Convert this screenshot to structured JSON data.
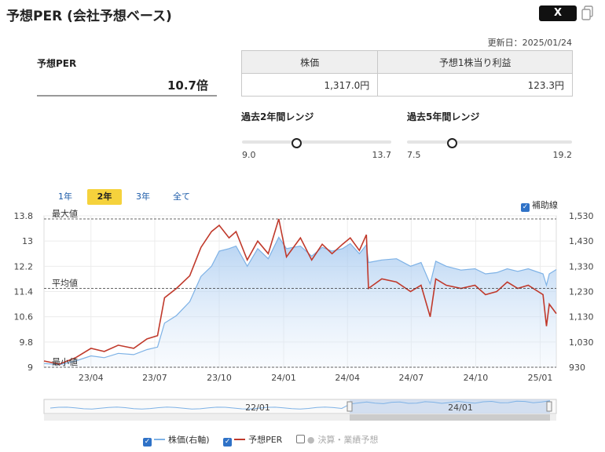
{
  "header": {
    "title": "予想PER (会社予想ベース)",
    "share_x_label": "X",
    "updated": "更新日：2025/01/24"
  },
  "per": {
    "label": "予想PER",
    "value": "10.7倍"
  },
  "table": {
    "headers": [
      "株価",
      "予想1株当り利益"
    ],
    "values": [
      "1,317.0円",
      "123.3円"
    ]
  },
  "ranges": [
    {
      "title": "過去2年間レンジ",
      "min": "9.0",
      "max": "13.7",
      "current": 10.7,
      "min_v": 9.0,
      "max_v": 13.7
    },
    {
      "title": "過去5年間レンジ",
      "min": "7.5",
      "max": "19.2",
      "current": 10.7,
      "min_v": 7.5,
      "max_v": 19.2
    }
  ],
  "period_tabs": [
    "1年",
    "2年",
    "3年",
    "全て"
  ],
  "active_tab": "2年",
  "aux_lines_label": "補助線",
  "legend": {
    "price": "株価(右軸)",
    "per": "予想PER",
    "forecast": "決算・業績予想"
  },
  "colors": {
    "price_line": "#7eb2e6",
    "per_line": "#c0392b",
    "active_tab": "#f5d23c",
    "checkbox": "#2f72c7"
  },
  "chart_data": {
    "type": "line",
    "left_axis": {
      "ticks": [
        "13.8",
        "13",
        "12.2",
        "11.4",
        "10.6",
        "9.8",
        "9"
      ],
      "range": [
        9,
        13.8
      ]
    },
    "right_axis": {
      "ticks": [
        "1,530",
        "1,430",
        "1,330",
        "1,230",
        "1,130",
        "1,030",
        "930"
      ],
      "range": [
        930,
        1530
      ]
    },
    "x_ticks": [
      "23/04",
      "23/07",
      "23/10",
      "24/01",
      "24/04",
      "24/07",
      "24/10",
      "25/01"
    ],
    "reference_lines": [
      {
        "label": "最大値",
        "value": 13.7
      },
      {
        "label": "平均値",
        "value": 11.5
      },
      {
        "label": "最小値",
        "value": 9.0
      }
    ],
    "navigator_ticks": [
      "22/01",
      "24/01"
    ],
    "series": [
      {
        "name": "予想PER",
        "axis": "left",
        "x": [
          "2023-01-24",
          "2023-02-15",
          "2023-03-10",
          "2023-04-01",
          "2023-04-20",
          "2023-05-10",
          "2023-06-01",
          "2023-06-20",
          "2023-07-05",
          "2023-07-15",
          "2023-08-01",
          "2023-08-20",
          "2023-09-05",
          "2023-09-20",
          "2023-10-01",
          "2023-10-15",
          "2023-10-25",
          "2023-11-10",
          "2023-11-25",
          "2023-12-10",
          "2023-12-25",
          "2024-01-05",
          "2024-01-25",
          "2024-02-10",
          "2024-02-25",
          "2024-03-10",
          "2024-03-25",
          "2024-04-05",
          "2024-04-18",
          "2024-04-28",
          "2024-05-01",
          "2024-05-20",
          "2024-06-10",
          "2024-06-30",
          "2024-07-15",
          "2024-07-28",
          "2024-08-05",
          "2024-08-20",
          "2024-09-10",
          "2024-09-30",
          "2024-10-15",
          "2024-10-31",
          "2024-11-15",
          "2024-11-30",
          "2024-12-15",
          "2025-01-05",
          "2025-01-10",
          "2025-01-14",
          "2025-01-24"
        ],
        "values": [
          9.2,
          9.1,
          9.3,
          9.6,
          9.5,
          9.7,
          9.6,
          9.9,
          10.0,
          11.2,
          11.5,
          11.9,
          12.8,
          13.3,
          13.5,
          13.1,
          13.3,
          12.4,
          13.0,
          12.6,
          13.7,
          12.5,
          13.1,
          12.4,
          12.9,
          12.6,
          12.9,
          13.1,
          12.7,
          13.2,
          11.5,
          11.8,
          11.7,
          11.4,
          11.6,
          10.6,
          11.8,
          11.6,
          11.5,
          11.6,
          11.3,
          11.4,
          11.7,
          11.5,
          11.6,
          11.3,
          10.3,
          11.0,
          10.7
        ]
      },
      {
        "name": "株価",
        "axis": "right",
        "x": [
          "2023-01-24",
          "2023-02-15",
          "2023-03-10",
          "2023-04-01",
          "2023-04-20",
          "2023-05-10",
          "2023-06-01",
          "2023-06-20",
          "2023-07-05",
          "2023-07-15",
          "2023-08-01",
          "2023-08-20",
          "2023-09-05",
          "2023-09-20",
          "2023-10-01",
          "2023-10-15",
          "2023-10-25",
          "2023-11-10",
          "2023-11-25",
          "2023-12-10",
          "2023-12-25",
          "2024-01-05",
          "2024-01-25",
          "2024-02-10",
          "2024-02-25",
          "2024-03-10",
          "2024-03-25",
          "2024-04-05",
          "2024-04-18",
          "2024-04-28",
          "2024-05-01",
          "2024-05-20",
          "2024-06-10",
          "2024-06-30",
          "2024-07-15",
          "2024-07-28",
          "2024-08-05",
          "2024-08-20",
          "2024-09-10",
          "2024-09-30",
          "2024-10-15",
          "2024-10-31",
          "2024-11-15",
          "2024-11-30",
          "2024-12-15",
          "2025-01-05",
          "2025-01-10",
          "2025-01-14",
          "2025-01-24"
        ],
        "values": [
          945,
          940,
          955,
          975,
          968,
          985,
          980,
          1000,
          1010,
          1105,
          1135,
          1190,
          1290,
          1330,
          1390,
          1400,
          1410,
          1330,
          1400,
          1360,
          1445,
          1400,
          1410,
          1370,
          1405,
          1390,
          1400,
          1420,
          1380,
          1415,
          1345,
          1355,
          1360,
          1330,
          1345,
          1260,
          1350,
          1330,
          1315,
          1320,
          1300,
          1305,
          1320,
          1310,
          1320,
          1300,
          1255,
          1300,
          1317
        ]
      }
    ]
  }
}
